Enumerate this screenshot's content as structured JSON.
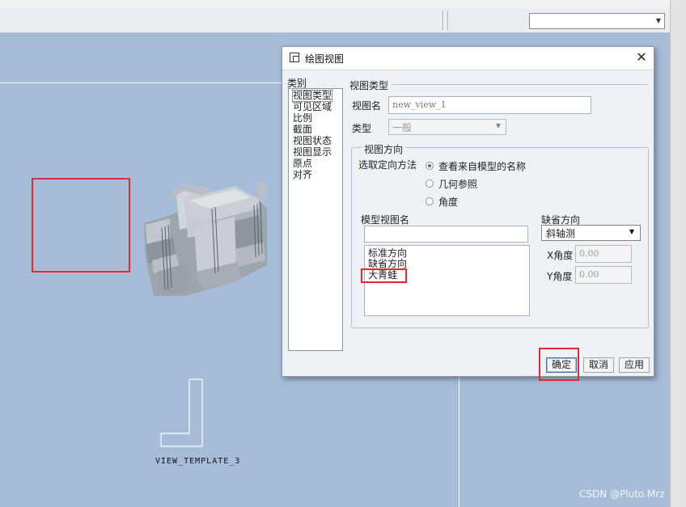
{
  "toolbar": {
    "dropdown_value": ""
  },
  "canvas": {
    "view_label": "VIEW_TEMPLATE_3",
    "watermark": "CSDN @Pluto.Mrz"
  },
  "dialog": {
    "title": "绘图视图",
    "close_glyph": "✕",
    "categories_label": "类别",
    "categories": [
      "视图类型",
      "可见区域",
      "比例",
      "截面",
      "视图状态",
      "视图显示",
      "原点",
      "对齐"
    ],
    "selected_category": "视图类型",
    "view_type_section": "视图类型",
    "view_name_label": "视图名",
    "view_name_value": "new_view_1",
    "type_label": "类型",
    "type_value": "一般",
    "orientation_section": "视图方向",
    "orientation_method_label": "选取定向方法",
    "orientation_options": [
      "查看来自模型的名称",
      "几何参照",
      "角度"
    ],
    "orientation_selected": "查看来自模型的名称",
    "model_view_names_label": "模型视图名",
    "model_view_filter": "",
    "model_views": [
      "标准方向",
      "缺省方向",
      "大青蛙"
    ],
    "default_orientation_label": "缺省方向",
    "default_orientation_value": "斜轴测",
    "x_angle_label": "X角度",
    "x_angle_value": "0.00",
    "y_angle_label": "Y角度",
    "y_angle_value": "0.00",
    "ok_label": "确定",
    "cancel_label": "取消",
    "apply_label": "应用"
  },
  "colors": {
    "canvas_bg": "#a5bdd6",
    "highlight": "#e8282f",
    "dialog_bg": "#edf2f7"
  }
}
